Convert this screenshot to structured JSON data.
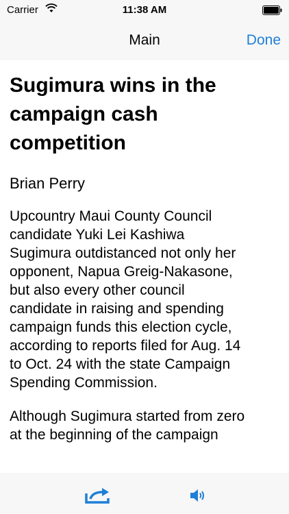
{
  "status_bar": {
    "carrier": "Carrier",
    "time": "11:38 AM",
    "icons": [
      "wifi-icon",
      "battery-icon"
    ]
  },
  "nav": {
    "title": "Main",
    "done_label": "Done",
    "accent_color": "#1f7fd6"
  },
  "article": {
    "headline_lines": [
      "Sugimura wins in the",
      "campaign cash",
      "competition"
    ],
    "byline": "Brian Perry",
    "paragraphs": [
      [
        "Upcountry Maui County Council",
        "candidate Yuki Lei Kashiwa",
        "Sugimura outdistanced not only her",
        "opponent, Napua Greig-Nakasone,",
        "but also every other council",
        "candidate in raising and spending",
        "campaign funds this election cycle,",
        "according to reports filed for Aug. 14",
        "to Oct. 24 with the state Campaign",
        "Spending Commission."
      ],
      [
        "Although Sugimura started from zero",
        "at the beginning of the campaign"
      ]
    ]
  },
  "toolbar": {
    "icons": [
      "share-icon",
      "speaker-icon"
    ]
  }
}
